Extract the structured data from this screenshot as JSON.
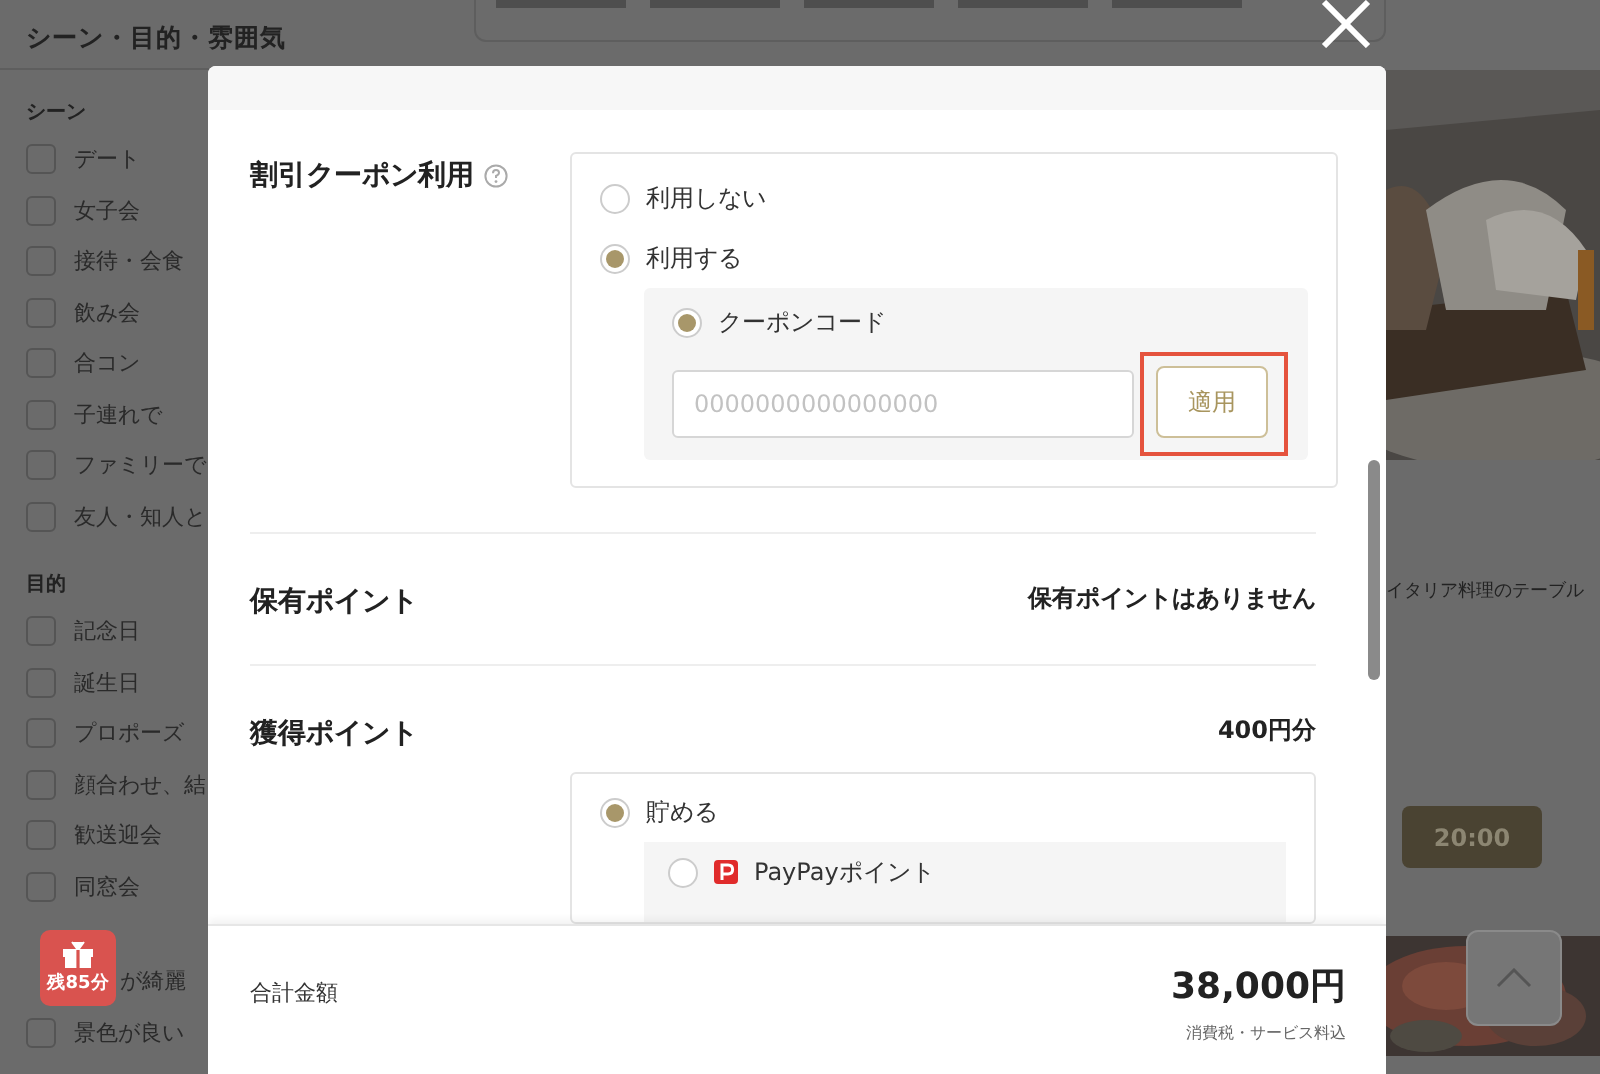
{
  "sidebar": {
    "title": "シーン・目的・雰囲気",
    "groups": [
      {
        "heading": "シーン",
        "items": [
          {
            "label": "デート",
            "checked": false
          },
          {
            "label": "女子会",
            "checked": false
          },
          {
            "label": "接待・会食",
            "checked": false
          },
          {
            "label": "飲み会",
            "checked": false
          },
          {
            "label": "合コン",
            "checked": false
          },
          {
            "label": "子連れで",
            "checked": false
          },
          {
            "label": "ファミリーで",
            "checked": false
          },
          {
            "label": "友人・知人と",
            "checked": false
          }
        ]
      },
      {
        "heading": "目的",
        "items": [
          {
            "label": "記念日",
            "checked": false
          },
          {
            "label": "誕生日",
            "checked": false
          },
          {
            "label": "プロポーズ",
            "checked": false
          },
          {
            "label": "顔合わせ、結",
            "checked": false
          },
          {
            "label": "歓送迎会",
            "checked": false
          },
          {
            "label": "同窓会",
            "checked": false
          }
        ]
      },
      {
        "items": [
          {
            "label": "が綺麗",
            "kind": "covered"
          },
          {
            "label": "景色が良い",
            "checked": false
          }
        ]
      }
    ]
  },
  "timer_badge": {
    "label": "残85分"
  },
  "background_content": {
    "description": "イタリア料理のテーブル",
    "time_slot": "20:00"
  },
  "modal": {
    "coupon": {
      "title": "割引クーポン利用",
      "options": [
        {
          "label": "利用しない",
          "selected": false
        },
        {
          "label": "利用する",
          "selected": true
        }
      ],
      "code_option": {
        "label": "クーポンコード",
        "selected": true
      },
      "code_field": {
        "placeholder": "0000000000000000"
      },
      "apply_button": {
        "label": "適用",
        "highlighted": true
      }
    },
    "held_points": {
      "title": "保有ポイント",
      "value": "保有ポイントはありません"
    },
    "earned_points": {
      "title": "獲得ポイント",
      "value": "400円分",
      "options": [
        {
          "label": "貯める",
          "selected": true
        }
      ],
      "sub_options": [
        {
          "label": "PayPayポイント",
          "selected": false,
          "kind": "paypay"
        }
      ]
    },
    "footer": {
      "total_label": "合計金額",
      "total": "38,000円",
      "note": "消費税・サービス料込"
    }
  }
}
